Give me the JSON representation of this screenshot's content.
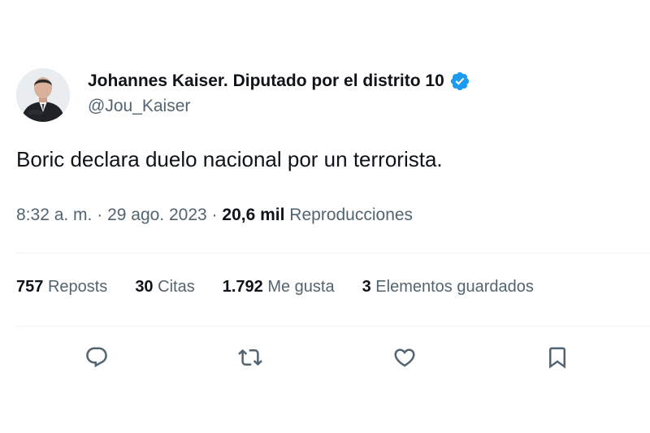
{
  "author": {
    "display_name": "Johannes Kaiser. Diputado por el distrito 10",
    "handle": "@Jou_Kaiser",
    "verified": true,
    "verified_color": "#1d9bf0"
  },
  "tweet": {
    "text": "Boric declara duelo nacional por un terrorista."
  },
  "meta": {
    "time": "8:32 a. m.",
    "separator": "·",
    "date": "29 ago. 2023",
    "views_count": "20,6 mil",
    "views_label": "Reproducciones"
  },
  "stats": [
    {
      "count": "757",
      "label": "Reposts"
    },
    {
      "count": "30",
      "label": "Citas"
    },
    {
      "count": "1.792",
      "label": "Me gusta"
    },
    {
      "count": "3",
      "label": "Elementos guardados"
    }
  ],
  "actions": [
    {
      "icon": "reply-icon"
    },
    {
      "icon": "repost-icon"
    },
    {
      "icon": "like-icon"
    },
    {
      "icon": "bookmark-icon"
    }
  ],
  "colors": {
    "primary_text": "#0f1419",
    "secondary_text": "#536471",
    "divider": "#eff3f4"
  }
}
